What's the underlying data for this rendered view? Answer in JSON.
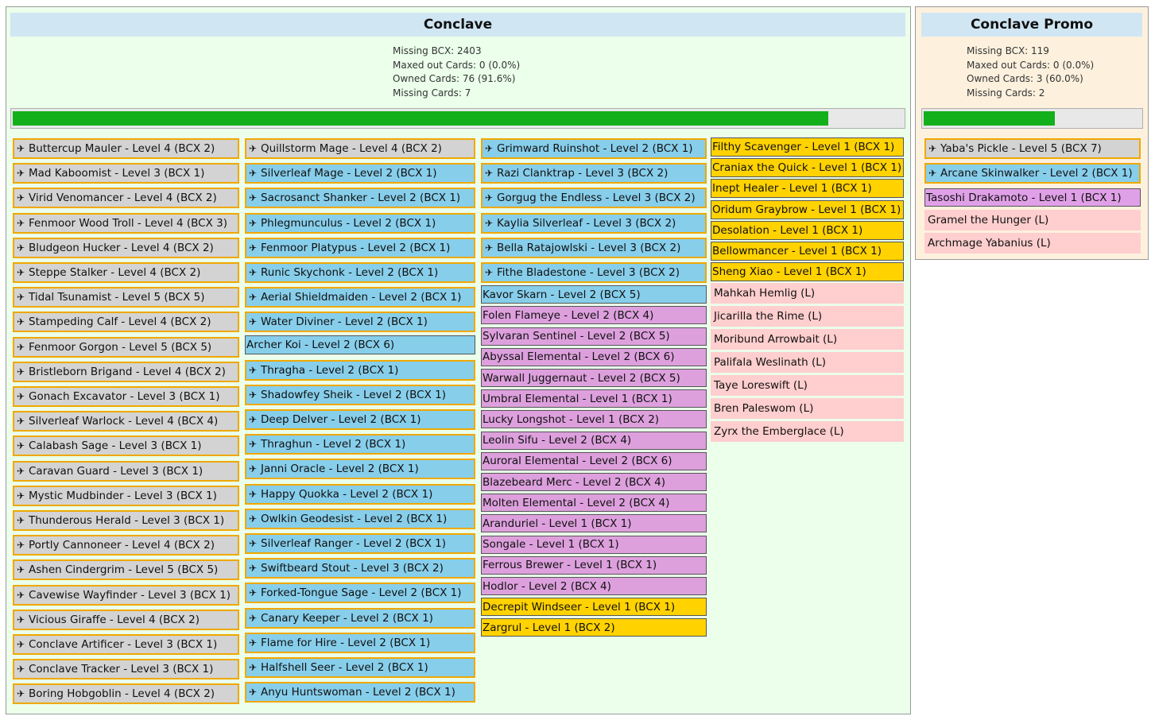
{
  "main": {
    "title": "Conclave",
    "stats": {
      "missing_bcx": "Missing BCX: 2403",
      "maxed": "Maxed out Cards: 0 (0.0%)",
      "owned": "Owned Cards: 76 (91.6%)",
      "missing_cards": "Missing Cards: 7"
    },
    "progress": 0.916
  },
  "promo": {
    "title": "Conclave Promo",
    "stats": {
      "missing_bcx": "Missing BCX: 119",
      "maxed": "Maxed out Cards: 0 (0.0%)",
      "owned": "Owned Cards: 3 (60.0%)",
      "missing_cards": "Missing Cards: 2"
    },
    "progress": 0.6
  },
  "colors": {
    "gray": "#d3d3d3",
    "blue": "#87ceeb",
    "purple": "#dda0dd",
    "gold": "#ffd200",
    "pink": "#ffcece",
    "gold_border": "#f0a800",
    "progress_fill": "#14b01c"
  },
  "pin_icon": "pushpin-icon",
  "columns": [
    {
      "cards": [
        {
          "label": "Buttercup Mauler - Level 4 (BCX 2)",
          "color": "gray",
          "pinned": true
        },
        {
          "label": "Mad Kaboomist - Level 3 (BCX 1)",
          "color": "gray",
          "pinned": true
        },
        {
          "label": "Virid Venomancer - Level 4 (BCX 2)",
          "color": "gray",
          "pinned": true
        },
        {
          "label": "Fenmoor Wood Troll - Level 4 (BCX 3)",
          "color": "gray",
          "pinned": true
        },
        {
          "label": "Bludgeon Hucker - Level 4 (BCX 2)",
          "color": "gray",
          "pinned": true
        },
        {
          "label": "Steppe Stalker - Level 4 (BCX 2)",
          "color": "gray",
          "pinned": true
        },
        {
          "label": "Tidal Tsunamist - Level 5 (BCX 5)",
          "color": "gray",
          "pinned": true
        },
        {
          "label": "Stampeding Calf - Level 4 (BCX 2)",
          "color": "gray",
          "pinned": true
        },
        {
          "label": "Fenmoor Gorgon - Level 5 (BCX 5)",
          "color": "gray",
          "pinned": true
        },
        {
          "label": "Bristleborn Brigand - Level 4 (BCX 2)",
          "color": "gray",
          "pinned": true
        },
        {
          "label": "Gonach Excavator - Level 3 (BCX 1)",
          "color": "gray",
          "pinned": true
        },
        {
          "label": "Silverleaf Warlock - Level 4 (BCX 4)",
          "color": "gray",
          "pinned": true
        },
        {
          "label": "Calabash Sage - Level 3 (BCX 1)",
          "color": "gray",
          "pinned": true
        },
        {
          "label": "Caravan Guard - Level 3 (BCX 1)",
          "color": "gray",
          "pinned": true
        },
        {
          "label": "Mystic Mudbinder - Level 3 (BCX 1)",
          "color": "gray",
          "pinned": true
        },
        {
          "label": "Thunderous Herald - Level 3 (BCX 1)",
          "color": "gray",
          "pinned": true
        },
        {
          "label": "Portly Cannoneer - Level 4 (BCX 2)",
          "color": "gray",
          "pinned": true
        },
        {
          "label": "Ashen Cindergrim - Level 5 (BCX 5)",
          "color": "gray",
          "pinned": true
        },
        {
          "label": "Cavewise Wayfinder - Level 3 (BCX 1)",
          "color": "gray",
          "pinned": true
        },
        {
          "label": "Vicious Giraffe - Level 4 (BCX 2)",
          "color": "gray",
          "pinned": true
        },
        {
          "label": "Conclave Artificer - Level 3 (BCX 1)",
          "color": "gray",
          "pinned": true
        },
        {
          "label": "Conclave Tracker - Level 3 (BCX 1)",
          "color": "gray",
          "pinned": true
        },
        {
          "label": "Boring Hobgoblin - Level 4 (BCX 2)",
          "color": "gray",
          "pinned": true
        }
      ]
    },
    {
      "cards": [
        {
          "label": "Quillstorm Mage - Level 4 (BCX 2)",
          "color": "gray",
          "pinned": true
        },
        {
          "label": "Silverleaf Mage - Level 2 (BCX 1)",
          "color": "blue",
          "pinned": true
        },
        {
          "label": "Sacrosanct Shanker - Level 2 (BCX 1)",
          "color": "blue",
          "pinned": true
        },
        {
          "label": "Phlegmunculus - Level 2 (BCX 1)",
          "color": "blue",
          "pinned": true
        },
        {
          "label": "Fenmoor Platypus - Level 2 (BCX 1)",
          "color": "blue",
          "pinned": true
        },
        {
          "label": "Runic Skychonk - Level 2 (BCX 1)",
          "color": "blue",
          "pinned": true
        },
        {
          "label": "Aerial Shieldmaiden - Level 2 (BCX 1)",
          "color": "blue",
          "pinned": true
        },
        {
          "label": "Water Diviner - Level 2 (BCX 1)",
          "color": "blue",
          "pinned": true
        },
        {
          "label": "Archer Koi - Level 2 (BCX 6)",
          "color": "blue",
          "pinned": false
        },
        {
          "label": "Thragha - Level 2 (BCX 1)",
          "color": "blue",
          "pinned": true
        },
        {
          "label": "Shadowfey Sheik - Level 2 (BCX 1)",
          "color": "blue",
          "pinned": true
        },
        {
          "label": "Deep Delver - Level 2 (BCX 1)",
          "color": "blue",
          "pinned": true
        },
        {
          "label": "Thraghun - Level 2 (BCX 1)",
          "color": "blue",
          "pinned": true
        },
        {
          "label": "Janni Oracle - Level 2 (BCX 1)",
          "color": "blue",
          "pinned": true
        },
        {
          "label": "Happy Quokka - Level 2 (BCX 1)",
          "color": "blue",
          "pinned": true
        },
        {
          "label": "Owlkin Geodesist - Level 2 (BCX 1)",
          "color": "blue",
          "pinned": true
        },
        {
          "label": "Silverleaf Ranger - Level 2 (BCX 1)",
          "color": "blue",
          "pinned": true
        },
        {
          "label": "Swiftbeard Stout - Level 3 (BCX 2)",
          "color": "blue",
          "pinned": true
        },
        {
          "label": "Forked-Tongue Sage - Level 2 (BCX 1)",
          "color": "blue",
          "pinned": true
        },
        {
          "label": "Canary Keeper - Level 2 (BCX 1)",
          "color": "blue",
          "pinned": true
        },
        {
          "label": "Flame for Hire - Level 2 (BCX 1)",
          "color": "blue",
          "pinned": true
        },
        {
          "label": "Halfshell Seer - Level 2 (BCX 1)",
          "color": "blue",
          "pinned": true
        },
        {
          "label": "Anyu Huntswoman - Level 2 (BCX 1)",
          "color": "blue",
          "pinned": true
        }
      ]
    },
    {
      "cards": [
        {
          "label": "Grimward Ruinshot - Level 2 (BCX 1)",
          "color": "blue",
          "pinned": true
        },
        {
          "label": "Razi Clanktrap - Level 3 (BCX 2)",
          "color": "blue",
          "pinned": true
        },
        {
          "label": "Gorgug the Endless - Level 3 (BCX 2)",
          "color": "blue",
          "pinned": true
        },
        {
          "label": "Kaylia Silverleaf - Level 3 (BCX 2)",
          "color": "blue",
          "pinned": true
        },
        {
          "label": "Bella Ratajowlski - Level 3 (BCX 2)",
          "color": "blue",
          "pinned": true
        },
        {
          "label": "Fithe Bladestone - Level 3 (BCX 2)",
          "color": "blue",
          "pinned": true
        },
        {
          "label": "Kavor Skarn - Level 2 (BCX 5)",
          "color": "blue",
          "pinned": false
        },
        {
          "label": "Folen Flameye - Level 2 (BCX 4)",
          "color": "purple",
          "pinned": false
        },
        {
          "label": "Sylvaran Sentinel - Level 2 (BCX 5)",
          "color": "purple",
          "pinned": false
        },
        {
          "label": "Abyssal Elemental - Level 2 (BCX 6)",
          "color": "purple",
          "pinned": false
        },
        {
          "label": "Warwall Juggernaut - Level 2 (BCX 5)",
          "color": "purple",
          "pinned": false
        },
        {
          "label": "Umbral Elemental - Level 1 (BCX 1)",
          "color": "purple",
          "pinned": false
        },
        {
          "label": "Lucky Longshot - Level 1 (BCX 2)",
          "color": "purple",
          "pinned": false
        },
        {
          "label": "Leolin Sifu - Level 2 (BCX 4)",
          "color": "purple",
          "pinned": false
        },
        {
          "label": "Auroral Elemental - Level 2 (BCX 6)",
          "color": "purple",
          "pinned": false
        },
        {
          "label": "Blazebeard Merc - Level 2 (BCX 4)",
          "color": "purple",
          "pinned": false
        },
        {
          "label": "Molten Elemental - Level 2 (BCX 4)",
          "color": "purple",
          "pinned": false
        },
        {
          "label": "Aranduriel - Level 1 (BCX 1)",
          "color": "purple",
          "pinned": false
        },
        {
          "label": "Songale - Level 1 (BCX 1)",
          "color": "purple",
          "pinned": false
        },
        {
          "label": "Ferrous Brewer - Level 1 (BCX 1)",
          "color": "purple",
          "pinned": false
        },
        {
          "label": "Hodlor - Level 2 (BCX 4)",
          "color": "purple",
          "pinned": false
        },
        {
          "label": "Decrepit Windseer - Level 1 (BCX 1)",
          "color": "gold",
          "pinned": false
        },
        {
          "label": "Zargrul - Level 1 (BCX 2)",
          "color": "gold",
          "pinned": false
        }
      ]
    },
    {
      "cards": [
        {
          "label": "Filthy Scavenger - Level 1 (BCX 1)",
          "color": "gold",
          "pinned": false
        },
        {
          "label": "Craniax the Quick - Level 1 (BCX 1)",
          "color": "gold",
          "pinned": false
        },
        {
          "label": "Inept Healer - Level 1 (BCX 1)",
          "color": "gold",
          "pinned": false
        },
        {
          "label": "Oridum Graybrow - Level 1 (BCX 1)",
          "color": "gold",
          "pinned": false
        },
        {
          "label": "Desolation - Level 1 (BCX 1)",
          "color": "gold",
          "pinned": false
        },
        {
          "label": "Bellowmancer - Level 1 (BCX 1)",
          "color": "gold",
          "pinned": false
        },
        {
          "label": "Sheng Xiao - Level 1 (BCX 1)",
          "color": "gold",
          "pinned": false
        },
        {
          "label": "Mahkah Hemlig (L)",
          "color": "pink",
          "pinned": false
        },
        {
          "label": "Jicarilla the Rime (L)",
          "color": "pink",
          "pinned": false
        },
        {
          "label": "Moribund Arrowbait (L)",
          "color": "pink",
          "pinned": false
        },
        {
          "label": "Palifala Weslinath (L)",
          "color": "pink",
          "pinned": false
        },
        {
          "label": "Taye Loreswift (L)",
          "color": "pink",
          "pinned": false
        },
        {
          "label": "Bren Paleswom (L)",
          "color": "pink",
          "pinned": false
        },
        {
          "label": "Zyrx the Emberglace (L)",
          "color": "pink",
          "pinned": false
        }
      ]
    }
  ],
  "promo_cards": [
    {
      "label": "Yaba's Pickle - Level 5 (BCX 7)",
      "color": "gray",
      "pinned": true
    },
    {
      "label": "Arcane Skinwalker - Level 2 (BCX 1)",
      "color": "blue",
      "pinned": true
    },
    {
      "label": "Tasoshi Drakamoto - Level 1 (BCX 1)",
      "color": "violet",
      "pinned": false
    },
    {
      "label": "Gramel the Hunger (L)",
      "color": "pink",
      "pinned": false
    },
    {
      "label": "Archmage Yabanius (L)",
      "color": "pink",
      "pinned": false
    }
  ]
}
